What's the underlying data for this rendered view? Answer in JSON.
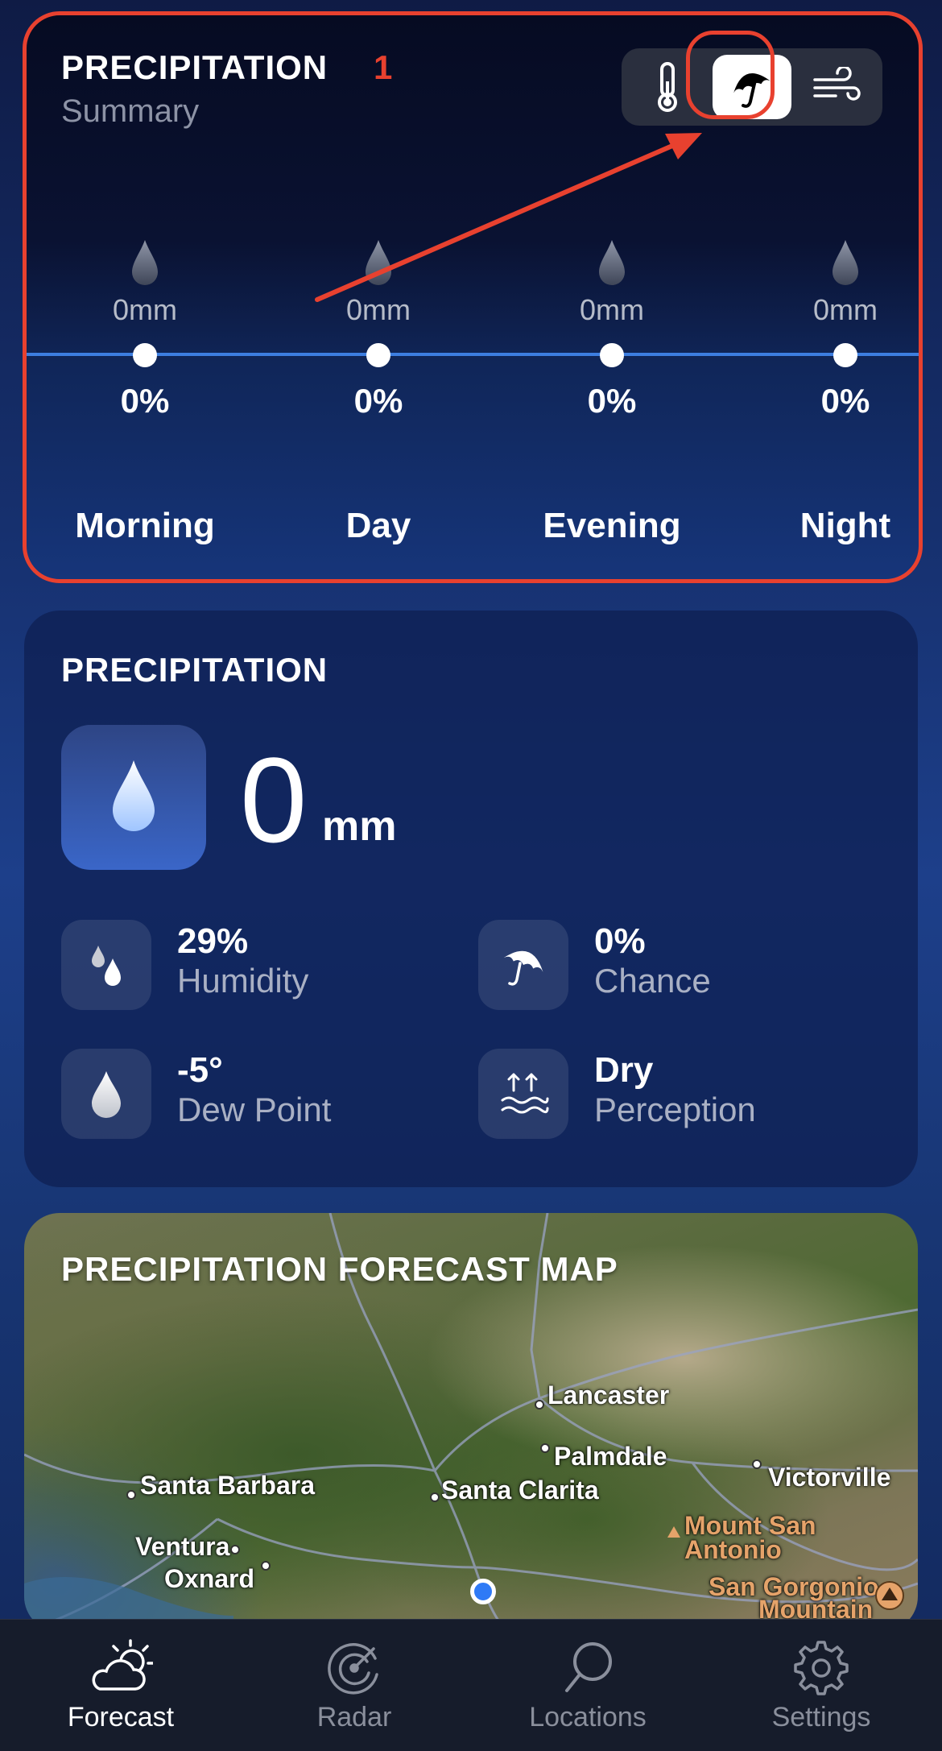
{
  "summary": {
    "title": "PRECIPITATION",
    "annotation_number": "1",
    "subtitle": "Summary",
    "toggles": [
      {
        "icon": "thermometer-icon",
        "active": false
      },
      {
        "icon": "umbrella-icon",
        "active": true
      },
      {
        "icon": "wind-icon",
        "active": false
      }
    ],
    "periods": [
      {
        "label": "Morning",
        "amount": "0mm",
        "chance": "0%"
      },
      {
        "label": "Day",
        "amount": "0mm",
        "chance": "0%"
      },
      {
        "label": "Evening",
        "amount": "0mm",
        "chance": "0%"
      },
      {
        "label": "Night",
        "amount": "0mm",
        "chance": "0%"
      }
    ]
  },
  "details": {
    "title": "PRECIPITATION",
    "value": "0",
    "unit": "mm",
    "stats": [
      {
        "value": "29%",
        "label": "Humidity",
        "icon": "droplets-icon"
      },
      {
        "value": "0%",
        "label": "Chance",
        "icon": "umbrella-icon"
      },
      {
        "value": "-5°",
        "label": "Dew Point",
        "icon": "drop-icon"
      },
      {
        "value": "Dry",
        "label": "Perception",
        "icon": "evaporation-icon"
      }
    ]
  },
  "map": {
    "title": "PRECIPITATION FORECAST MAP",
    "places": [
      "Lancaster",
      "Palmdale",
      "Santa Barbara",
      "Santa Clarita",
      "Victorville",
      "Ventura",
      "Oxnard",
      "Mount San",
      "Antonio",
      "San Gorgonio",
      "Mountain"
    ]
  },
  "tabs": [
    {
      "label": "Forecast",
      "icon": "partly-sunny-icon",
      "active": true
    },
    {
      "label": "Radar",
      "icon": "radar-icon",
      "active": false
    },
    {
      "label": "Locations",
      "icon": "search-icon",
      "active": false
    },
    {
      "label": "Settings",
      "icon": "gear-icon",
      "active": false
    }
  ],
  "colors": {
    "annotation": "#e8412f",
    "chart_line": "#3d7ee0",
    "user_location": "#2f7af6"
  }
}
